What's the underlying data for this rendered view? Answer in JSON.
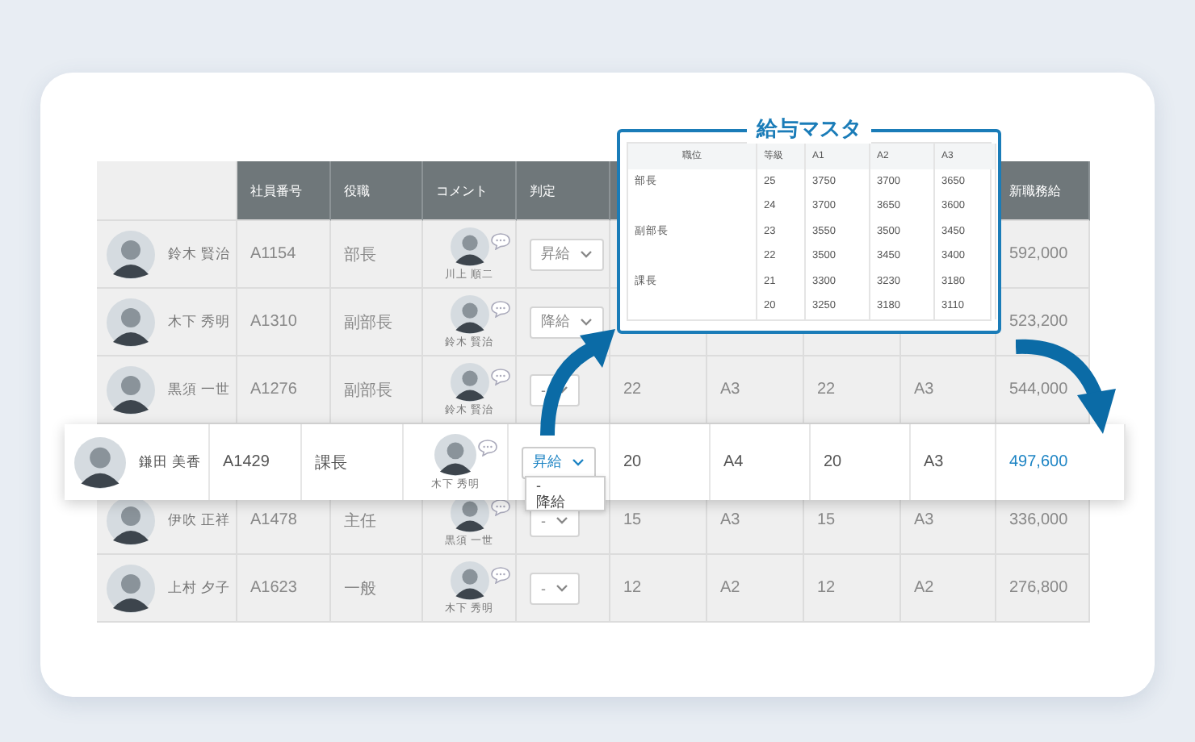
{
  "table": {
    "columns": [
      {
        "label": "社員番号"
      },
      {
        "label": "役職"
      },
      {
        "label": "コメント"
      },
      {
        "label": "判定"
      },
      {
        "label": "新職務給"
      }
    ],
    "rows": [
      {
        "name": "鈴木 賢治",
        "employee_no": "A1154",
        "position": "部長",
        "commenter": "川上 順二",
        "judgement": "昇給",
        "new_salary": "592,000",
        "highlighted": false
      },
      {
        "name": "木下 秀明",
        "employee_no": "A1310",
        "position": "副部長",
        "commenter": "鈴木 賢治",
        "judgement": "降給",
        "new_salary": "523,200",
        "highlighted": false
      },
      {
        "name": "黒須 一世",
        "employee_no": "A1276",
        "position": "副部長",
        "commenter": "鈴木 賢治",
        "judgement": "-",
        "column_6": "22",
        "column_7": "A3",
        "column_8": "22",
        "column_9": "A3",
        "new_salary": "544,000",
        "highlighted": false
      },
      {
        "name": "鎌田 美香",
        "employee_no": "A1429",
        "position": "課長",
        "commenter": "木下 秀明",
        "judgement": "昇給",
        "judgement_options": [
          "-",
          "降給"
        ],
        "column_6": "20",
        "column_7": "A4",
        "column_8": "20",
        "column_9": "A3",
        "new_salary": "497,600",
        "highlighted": true
      },
      {
        "name": "伊吹 正祥",
        "employee_no": "A1478",
        "position": "主任",
        "commenter": "黒須 一世",
        "judgement": "-",
        "column_6": "15",
        "column_7": "A3",
        "column_8": "15",
        "column_9": "A3",
        "new_salary": "336,000",
        "highlighted": false
      },
      {
        "name": "上村 夕子",
        "employee_no": "A1623",
        "position": "一般",
        "commenter": "木下 秀明",
        "judgement": "-",
        "column_6": "12",
        "column_7": "A2",
        "column_8": "12",
        "column_9": "A2",
        "new_salary": "276,800",
        "highlighted": false
      }
    ]
  },
  "salary_master": {
    "title": "給与マスタ",
    "columns": [
      "職位",
      "等級",
      "A1",
      "A2",
      "A3"
    ],
    "rows": [
      {
        "position": "部長",
        "grade": "25",
        "a1": "3750",
        "a2": "3700",
        "a3": "3650"
      },
      {
        "grade": "24",
        "a1": "3700",
        "a2": "3650",
        "a3": "3600"
      },
      {
        "position": "副部長",
        "grade": "23",
        "a1": "3550",
        "a2": "3500",
        "a3": "3450"
      },
      {
        "grade": "22",
        "a1": "3500",
        "a2": "3450",
        "a3": "3400"
      },
      {
        "position": "課長",
        "grade": "21",
        "a1": "3300",
        "a2": "3230",
        "a3": "3180"
      },
      {
        "grade": "20",
        "a1": "3250",
        "a2": "3180",
        "a3": "3110"
      }
    ]
  }
}
